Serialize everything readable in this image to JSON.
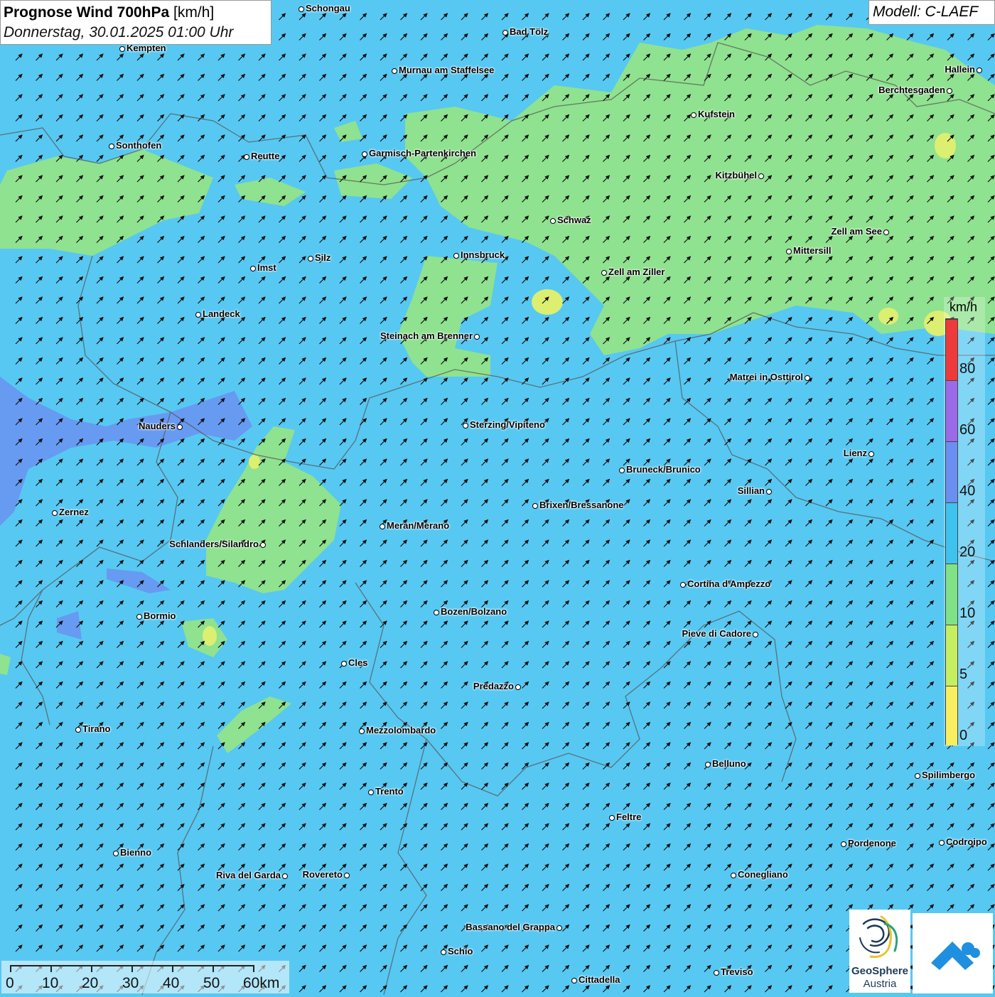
{
  "title": {
    "main": "Prognose Wind 700hPa",
    "unit": "[km/h]",
    "date": "Donnerstag, 30.01.2025 01:00 Uhr"
  },
  "model": "Modell: C-LAEF",
  "legend": {
    "unit": "km/h",
    "labels": [
      "80",
      "60",
      "40",
      "20",
      "10",
      "5",
      "0"
    ],
    "colors": [
      "#ee3a3a",
      "#9b6ae8",
      "#6b8ff0",
      "#3ec3ef",
      "#7fe286",
      "#c5ef60",
      "#f7ef60"
    ]
  },
  "scale": {
    "labels": [
      "0",
      "10",
      "20",
      "30",
      "40",
      "50",
      "60km"
    ]
  },
  "logo": {
    "name": "GeoSphere",
    "sub": "Austria"
  },
  "colors": {
    "wind_10_20": "#57c8f2",
    "wind_5_10": "#8fe28f",
    "wind_20_40": "#6b8ff0",
    "wind_0_5": "#e8ef70"
  },
  "cities": [
    {
      "name": "Schongau"
    },
    {
      "name": "Bad Tölz"
    },
    {
      "name": "Kempten"
    },
    {
      "name": "Murnau am Staffelsee"
    },
    {
      "name": "Hallein"
    },
    {
      "name": "Berchtesgaden"
    },
    {
      "name": "Kufstein"
    },
    {
      "name": "Sonthofen"
    },
    {
      "name": "Reutte"
    },
    {
      "name": "Garmisch-Partenkirchen"
    },
    {
      "name": "Kitzbühel"
    },
    {
      "name": "Schwaz"
    },
    {
      "name": "Zell am See"
    },
    {
      "name": "Mittersill"
    },
    {
      "name": "Innsbruck"
    },
    {
      "name": "Silz"
    },
    {
      "name": "Imst"
    },
    {
      "name": "Zell am Ziller"
    },
    {
      "name": "Landeck"
    },
    {
      "name": "Steinach am Brenner"
    },
    {
      "name": "Matrei in Osttirol"
    },
    {
      "name": "Nauders"
    },
    {
      "name": "Sterzing/Vipiteno"
    },
    {
      "name": "Lienz"
    },
    {
      "name": "Bruneck/Brunico"
    },
    {
      "name": "Sillian"
    },
    {
      "name": "Zernez"
    },
    {
      "name": "Brixen/Bressanone"
    },
    {
      "name": "Meran/Merano"
    },
    {
      "name": "Schlanders/Silandro"
    },
    {
      "name": "Cortina d'Ampezzo"
    },
    {
      "name": "Bozen/Bolzano"
    },
    {
      "name": "Bormio"
    },
    {
      "name": "Pieve di Cadore"
    },
    {
      "name": "Cles"
    },
    {
      "name": "Predazzo"
    },
    {
      "name": "Tirano"
    },
    {
      "name": "Mezzolombardo"
    },
    {
      "name": "Belluno"
    },
    {
      "name": "Spilimbergo"
    },
    {
      "name": "Trento"
    },
    {
      "name": "Feltre"
    },
    {
      "name": "Pordenone"
    },
    {
      "name": "Codroipo"
    },
    {
      "name": "Bienno"
    },
    {
      "name": "Riva del Garda"
    },
    {
      "name": "Rovereto"
    },
    {
      "name": "Conegliano"
    },
    {
      "name": "Bassano del Grappa"
    },
    {
      "name": "Schio"
    },
    {
      "name": "Treviso"
    },
    {
      "name": "Cittadella"
    }
  ]
}
